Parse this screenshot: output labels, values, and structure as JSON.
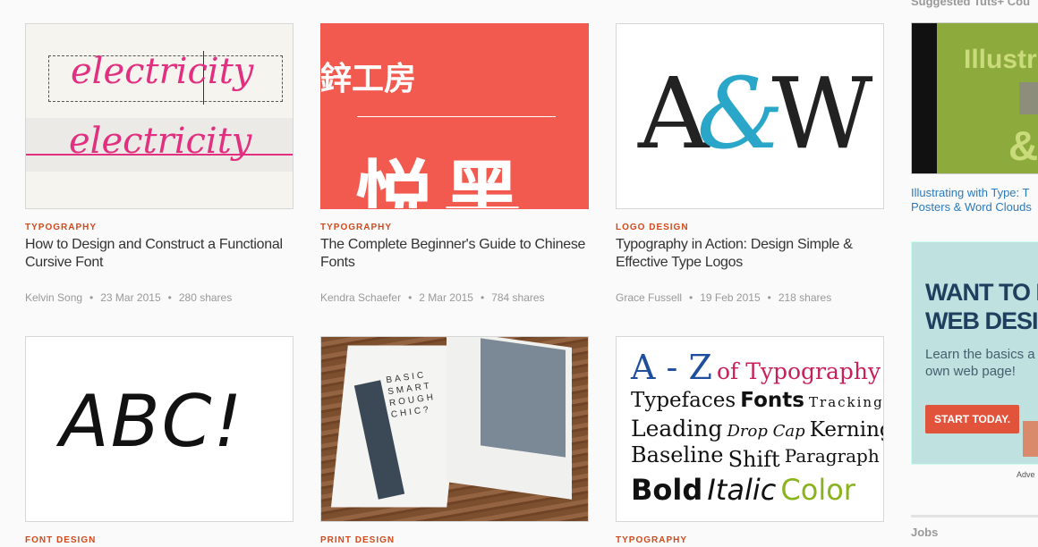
{
  "articles": [
    {
      "category": "TYPOGRAPHY",
      "title": "How to Design and Construct a Functional Cursive Font",
      "author": "Kelvin Song",
      "date": "23 Mar 2015",
      "shares": "280 shares",
      "thumb_text": "electricity"
    },
    {
      "category": "TYPOGRAPHY",
      "title": "The Complete Beginner's Guide to Chinese Fonts",
      "author": "Kendra Schaefer",
      "date": "2 Mar 2015",
      "shares": "784 shares",
      "thumb_text_top": "鋅工房",
      "thumb_text_main": "悦黑"
    },
    {
      "category": "LOGO DESIGN",
      "title": "Typography in Action: Design Simple & Effective Type Logos",
      "author": "Grace Fussell",
      "date": "19 Feb 2015",
      "shares": "218 shares",
      "thumb_a": "A",
      "thumb_amp": "&",
      "thumb_w": "W"
    },
    {
      "category": "FONT DESIGN",
      "thumb_text": "ABC!"
    },
    {
      "category": "PRINT DESIGN",
      "thumb_text": "BASIC SMART ROUGH CHIC?"
    },
    {
      "category": "TYPOGRAPHY",
      "thumb_lines": [
        "A - Z",
        "of Typography",
        "Typefaces",
        "Fonts",
        "Tracking",
        "Leading",
        "Drop Cap",
        "Kerning",
        "Baseline",
        "Shift",
        "Paragraph",
        "Bold",
        "Italic",
        "Color"
      ]
    }
  ],
  "meta_separator": "•",
  "sidebar": {
    "suggested_title": "Suggested Tuts+ Cou",
    "suggested_link": "Illustrating with Type: T",
    "suggested_link2": "Posters & Word Clouds",
    "suggested_thumb_text": "Illustr",
    "ad_headline_1": "WANT TO BE",
    "ad_headline_2": "WEB DESIG",
    "ad_body_1": "Learn the basics a",
    "ad_body_2": "own web page!",
    "ad_button": "START TODAY.",
    "ad_label": "Adve",
    "jobs_title": "Jobs"
  },
  "colors": {
    "category": "#d04a1c",
    "chinese_bg": "#f25a50",
    "amp": "#2aa6c8",
    "link": "#2a7abf"
  }
}
